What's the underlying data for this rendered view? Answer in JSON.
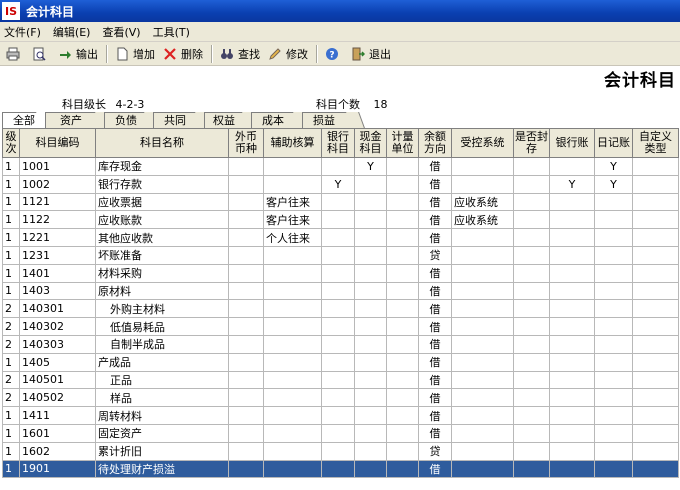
{
  "window": {
    "logo": "IS",
    "title": "会计科目"
  },
  "menu": [
    "文件(F)",
    "编辑(E)",
    "查看(V)",
    "工具(T)"
  ],
  "toolbar": {
    "output": "输出",
    "add": "增加",
    "delete": "删除",
    "find": "查找",
    "edit": "修改",
    "exit": "退出"
  },
  "page": {
    "title": "会计科目",
    "level_label": "科目级长",
    "level_value": "4-2-3",
    "count_label": "科目个数",
    "count_value": "18"
  },
  "tabs": [
    "全部",
    "资产",
    "负债",
    "共同",
    "权益",
    "成本",
    "损益"
  ],
  "active_tab": "全部",
  "columns": [
    "级次",
    "科目编码",
    "科目名称",
    "外币币种",
    "辅助核算",
    "银行科目",
    "现金科目",
    "计量单位",
    "余额方向",
    "受控系统",
    "是否封存",
    "银行账",
    "日记账",
    "自定义类型"
  ],
  "rows": [
    [
      "1",
      "1001",
      "库存现金",
      "",
      "",
      "",
      "Y",
      "",
      "借",
      "",
      "",
      "",
      "Y",
      ""
    ],
    [
      "1",
      "1002",
      "银行存款",
      "",
      "",
      "Y",
      "",
      "",
      "借",
      "",
      "",
      "Y",
      "Y",
      ""
    ],
    [
      "1",
      "1121",
      "应收票据",
      "",
      "客户往来",
      "",
      "",
      "",
      "借",
      "应收系统",
      "",
      "",
      "",
      ""
    ],
    [
      "1",
      "1122",
      "应收账款",
      "",
      "客户往来",
      "",
      "",
      "",
      "借",
      "应收系统",
      "",
      "",
      "",
      ""
    ],
    [
      "1",
      "1221",
      "其他应收款",
      "",
      "个人往来",
      "",
      "",
      "",
      "借",
      "",
      "",
      "",
      "",
      ""
    ],
    [
      "1",
      "1231",
      "坏账准备",
      "",
      "",
      "",
      "",
      "",
      "贷",
      "",
      "",
      "",
      "",
      ""
    ],
    [
      "1",
      "1401",
      "材料采购",
      "",
      "",
      "",
      "",
      "",
      "借",
      "",
      "",
      "",
      "",
      ""
    ],
    [
      "1",
      "1403",
      "原材料",
      "",
      "",
      "",
      "",
      "",
      "借",
      "",
      "",
      "",
      "",
      ""
    ],
    [
      "2",
      "140301",
      "外购主材料",
      "",
      "",
      "",
      "",
      "",
      "借",
      "",
      "",
      "",
      "",
      ""
    ],
    [
      "2",
      "140302",
      "低值易耗品",
      "",
      "",
      "",
      "",
      "",
      "借",
      "",
      "",
      "",
      "",
      ""
    ],
    [
      "2",
      "140303",
      "自制半成品",
      "",
      "",
      "",
      "",
      "",
      "借",
      "",
      "",
      "",
      "",
      ""
    ],
    [
      "1",
      "1405",
      "产成品",
      "",
      "",
      "",
      "",
      "",
      "借",
      "",
      "",
      "",
      "",
      ""
    ],
    [
      "2",
      "140501",
      "正品",
      "",
      "",
      "",
      "",
      "",
      "借",
      "",
      "",
      "",
      "",
      ""
    ],
    [
      "2",
      "140502",
      "样品",
      "",
      "",
      "",
      "",
      "",
      "借",
      "",
      "",
      "",
      "",
      ""
    ],
    [
      "1",
      "1411",
      "周转材料",
      "",
      "",
      "",
      "",
      "",
      "借",
      "",
      "",
      "",
      "",
      ""
    ],
    [
      "1",
      "1601",
      "固定资产",
      "",
      "",
      "",
      "",
      "",
      "借",
      "",
      "",
      "",
      "",
      ""
    ],
    [
      "1",
      "1602",
      "累计折旧",
      "",
      "",
      "",
      "",
      "",
      "贷",
      "",
      "",
      "",
      "",
      ""
    ],
    [
      "1",
      "1901",
      "待处理财产损溢",
      "",
      "",
      "",
      "",
      "",
      "借",
      "",
      "",
      "",
      "",
      ""
    ]
  ],
  "selected_row": 17,
  "colors": {
    "selection": "#2f5c9d",
    "titlebar": "#0a3fb0"
  }
}
